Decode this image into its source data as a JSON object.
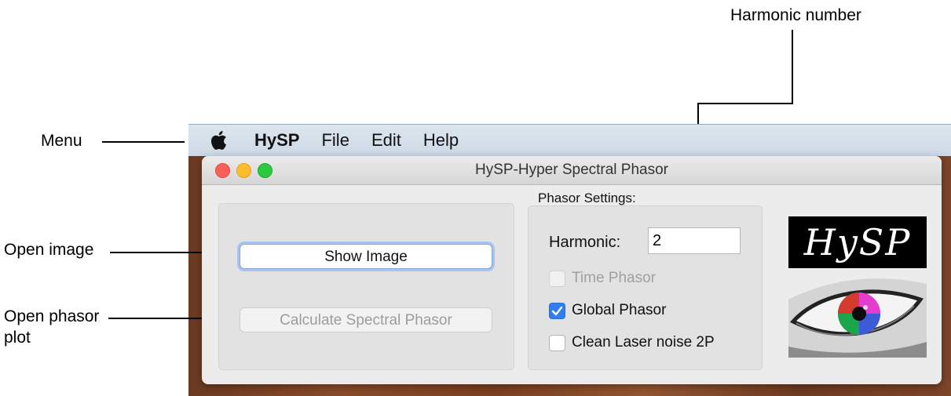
{
  "annotations": {
    "menu": "Menu",
    "open_image": "Open image",
    "open_phasor_plot": "Open phasor\nplot",
    "harmonic_number": "Harmonic number"
  },
  "menubar": {
    "apple_icon": "apple-logo-icon",
    "items": [
      "HySP",
      "File",
      "Edit",
      "Help"
    ]
  },
  "window": {
    "title": "HySP-Hyper Spectral Phasor",
    "traffic_lights": {
      "close": "#fc5f57",
      "minimize": "#fdbc2e",
      "maximize": "#2ac940"
    }
  },
  "left_panel": {
    "show_image_label": "Show Image",
    "calculate_label": "Calculate Spectral Phasor"
  },
  "phasor_settings": {
    "title": "Phasor Settings:",
    "harmonic_label": "Harmonic:",
    "harmonic_value": "2",
    "checkboxes": [
      {
        "label": "Time Phasor",
        "checked": false,
        "enabled": false
      },
      {
        "label": "Global Phasor",
        "checked": true,
        "enabled": true
      },
      {
        "label": "Clean Laser noise 2P",
        "checked": false,
        "enabled": true
      }
    ]
  },
  "logo": {
    "text": "HySP",
    "image_icon": "eye-image"
  },
  "colors": {
    "accent": "#2f7ef6",
    "focus_ring": "#a7c3ee"
  }
}
